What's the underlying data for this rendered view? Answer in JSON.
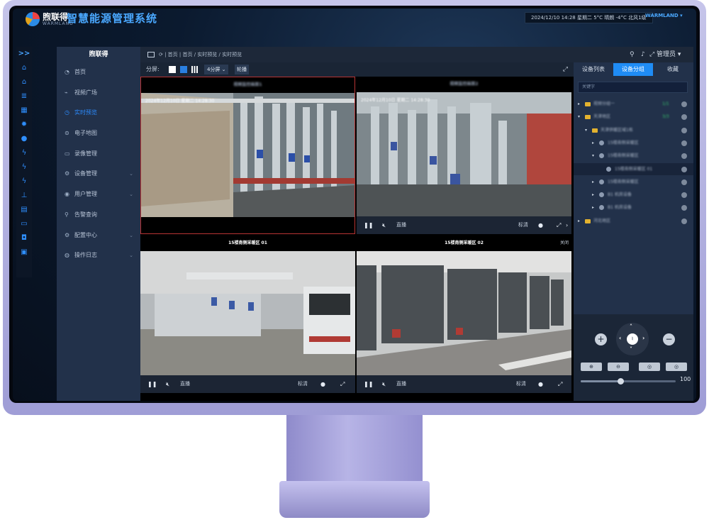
{
  "header": {
    "logo_text": "煦联得",
    "logo_sub": "WARMLAND",
    "system_title": "智慧能源管理系统",
    "weather": "2024/12/10 14:28 星期二 5°C 晴朗 -4°C 北风1级",
    "brand": "WARMLAND ▾"
  },
  "iconbar": {
    "toggle": ">>",
    "icons": [
      "home-icon",
      "home-icon",
      "list-icon",
      "grid-icon",
      "sun-icon",
      "water-icon",
      "bolt-icon",
      "bolt-icon",
      "flash-icon",
      "thermometer-icon",
      "table-icon",
      "monitor-icon",
      "chart-icon",
      "screen-icon"
    ]
  },
  "nav": {
    "brand": "煦联得",
    "items": [
      {
        "label": "首页",
        "icon": "dashboard-icon",
        "glyph": "◔"
      },
      {
        "label": "视频广场",
        "icon": "video-icon",
        "glyph": "⌁"
      },
      {
        "label": "实时预览",
        "icon": "preview-icon",
        "glyph": "◷",
        "active": true
      },
      {
        "label": "电子地图",
        "icon": "map-icon",
        "glyph": "⊜"
      },
      {
        "label": "录像管理",
        "icon": "recording-icon",
        "glyph": "▭"
      },
      {
        "label": "设备管理",
        "icon": "device-icon",
        "glyph": "⚙",
        "chevron": "⌄"
      },
      {
        "label": "用户管理",
        "icon": "user-icon",
        "glyph": "◉",
        "chevron": "⌄"
      },
      {
        "label": "告警查询",
        "icon": "alarm-icon",
        "glyph": "⚲"
      },
      {
        "label": "配置中心",
        "icon": "config-icon",
        "glyph": "⚙",
        "chevron": "⌄"
      },
      {
        "label": "操作日志",
        "icon": "log-icon",
        "glyph": "◍",
        "chevron": "⌄"
      }
    ]
  },
  "topbar": {
    "breadcrumb": "⟳ | 首页 | 首页 / 实时预览 / 实时预览",
    "admin": "管理员 ▾"
  },
  "toolbar": {
    "split_label": "分屏:",
    "split_select": "4分屏 ⌄",
    "rotate": "轮播"
  },
  "cells": [
    {
      "title": "视频监控画面1",
      "title_blur": true,
      "osd": "2024年12月10日 星期二 14:28:30",
      "selected": true,
      "has_ctrl": false
    },
    {
      "title": "视频监控画面2",
      "title_blur": true,
      "osd": "2024年12月10日 星期二 14:28:30",
      "has_ctrl": true
    },
    {
      "title": "15楼南侧采暖区 01",
      "has_ctrl": true
    },
    {
      "title": "15楼南侧采暖区 02",
      "close": "关闭",
      "has_ctrl": true
    }
  ],
  "controls": {
    "live": "直播",
    "hd": "标清"
  },
  "right_panel": {
    "tabs": [
      "设备列表",
      "设备分组",
      "收藏"
    ],
    "active_tab": 1,
    "search_placeholder": "关键字",
    "tree": [
      {
        "label": "视频分组一",
        "level": 0,
        "type": "folder",
        "expanded": false,
        "count": "1/1"
      },
      {
        "label": "天津地区",
        "level": 0,
        "type": "folder",
        "expanded": true,
        "count": "3/3"
      },
      {
        "label": "天津供暖区域1栋",
        "level": 1,
        "type": "folder",
        "expanded": true,
        "count": ""
      },
      {
        "label": "15楼南侧采暖区",
        "level": 2,
        "type": "camera",
        "expanded": false,
        "count": ""
      },
      {
        "label": "15楼南侧采暖区",
        "level": 2,
        "type": "camera",
        "expanded": true,
        "count": ""
      },
      {
        "label": "15楼南侧采暖区 01",
        "level": 3,
        "type": "camera",
        "highlight": true,
        "count": ""
      },
      {
        "label": "15楼南侧采暖区",
        "level": 2,
        "type": "camera",
        "expanded": false,
        "count": ""
      },
      {
        "label": "B1 机房设备",
        "level": 2,
        "type": "camera",
        "expanded": false,
        "count": ""
      },
      {
        "label": "B1 机房设备",
        "level": 2,
        "type": "camera",
        "expanded": false,
        "count": ""
      },
      {
        "label": "河北地区",
        "level": 0,
        "type": "folder",
        "expanded": false,
        "count": ""
      }
    ],
    "ptz": {
      "zoom_in": "+",
      "zoom_out": "−",
      "buttons": [
        "⊕",
        "⊖",
        "◎",
        "◎"
      ],
      "speed": 100,
      "speed_fraction": 0.42
    }
  }
}
